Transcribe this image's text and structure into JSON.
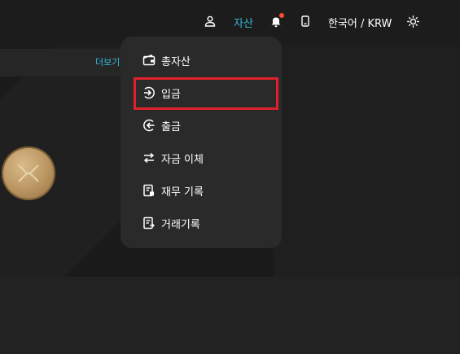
{
  "header": {
    "nav_assets": "자산",
    "nav_language_currency": "한국어 / KRW",
    "icons": [
      "user-icon",
      "bell-icon",
      "phone-icon",
      "sun-icon"
    ],
    "accent_color": "#35b8d9",
    "notification_dot_color": "#ff4a2f"
  },
  "background": {
    "more_link": "더보기"
  },
  "dropdown": {
    "items": [
      {
        "label": "총자산",
        "icon": "wallet-icon"
      },
      {
        "label": "입금",
        "icon": "deposit-icon",
        "highlighted": true
      },
      {
        "label": "출금",
        "icon": "withdraw-icon"
      },
      {
        "label": "자금 이체",
        "icon": "transfer-icon"
      },
      {
        "label": "재무 기록",
        "icon": "finance-record-icon"
      },
      {
        "label": "거래기록",
        "icon": "trade-record-icon"
      }
    ],
    "highlight_color": "#e0202a"
  }
}
